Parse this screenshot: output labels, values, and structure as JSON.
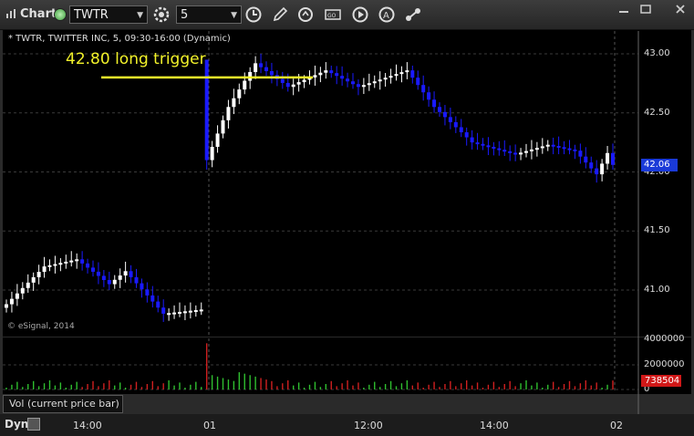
{
  "toolbar": {
    "title": "Chart",
    "symbol": "TWTR",
    "interval": "5"
  },
  "chart": {
    "symbol_title": "* TWTR, TWITTER INC, 5, 09:30-16:00 (Dynamic)",
    "annotation": "42.80 long trigger",
    "copyright": "© eSignal, 2014",
    "price_ticks": [
      "43.00",
      "42.50",
      "42.00",
      "41.50",
      "41.00"
    ],
    "current_price": "42.06",
    "volume_ticks": [
      "4000000",
      "2000000",
      "0"
    ],
    "current_volume": "738504",
    "volume_legend": "Vol (current price bar)",
    "time_ticks": [
      "14:00",
      "01",
      "12:00",
      "14:00",
      "02"
    ],
    "dyn_label": "Dyn",
    "colors": {
      "up": "#ffffff",
      "down": "#1a1aff",
      "trigger": "#f2f22a",
      "vol_up": "#2fbf2f",
      "vol_down": "#d02020"
    }
  },
  "chart_data": {
    "type": "candlestick",
    "title": "* TWTR, TWITTER INC, 5, 09:30-16:00 (Dynamic)",
    "ylim": [
      40.75,
      43.15
    ],
    "trigger_level": 42.8,
    "annotation": "42.80 long trigger",
    "last_price": 42.06,
    "volume_ylim": [
      0,
      4200000
    ],
    "last_volume": 738504,
    "x_tick_labels": [
      "14:00",
      "01",
      "12:00",
      "14:00",
      "02"
    ]
  }
}
